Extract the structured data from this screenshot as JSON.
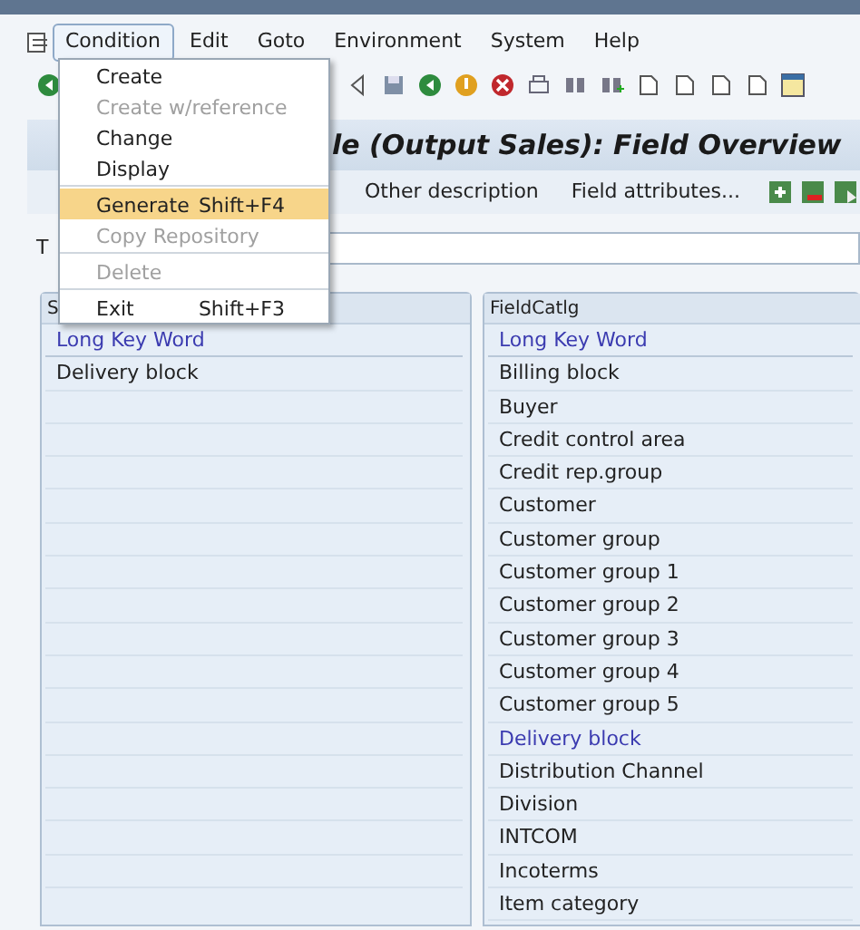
{
  "menu_bar": [
    {
      "label": "Condition",
      "selected": true
    },
    {
      "label": "Edit",
      "selected": false
    },
    {
      "label": "Goto",
      "selected": false
    },
    {
      "label": "Environment",
      "selected": false
    },
    {
      "label": "System",
      "selected": false
    },
    {
      "label": "Help",
      "selected": false
    }
  ],
  "dropdown": [
    {
      "kind": "item",
      "label": "Create",
      "disabled": false,
      "selected": false
    },
    {
      "kind": "item",
      "label": "Create w/reference",
      "disabled": true,
      "selected": false
    },
    {
      "kind": "item",
      "label": "Change",
      "disabled": false,
      "selected": false
    },
    {
      "kind": "item",
      "label": "Display",
      "disabled": false,
      "selected": false
    },
    {
      "kind": "separator"
    },
    {
      "kind": "item",
      "label": "Generate",
      "shortcut": "Shift+F4",
      "disabled": false,
      "selected": true
    },
    {
      "kind": "item",
      "label": "Copy Repository",
      "disabled": true,
      "selected": false
    },
    {
      "kind": "separator"
    },
    {
      "kind": "item",
      "label": "Delete",
      "disabled": true,
      "selected": false
    },
    {
      "kind": "separator"
    },
    {
      "kind": "item",
      "label": "Exit",
      "shortcut": "Shift+F3",
      "disabled": false,
      "selected": false
    }
  ],
  "title": "le (Output Sales): Field Overview",
  "app_toolbar": [
    "Other description",
    "Field attributes..."
  ],
  "field_label": "T",
  "left_pane": {
    "header": "S",
    "rows": [
      {
        "text": "Long Key Word",
        "kind": "heading"
      },
      {
        "text": "Delivery block",
        "kind": "normal"
      }
    ]
  },
  "right_pane": {
    "header": "FieldCatlg",
    "rows": [
      {
        "text": "Long Key Word",
        "kind": "heading"
      },
      {
        "text": "Billing block",
        "kind": "normal"
      },
      {
        "text": "Buyer",
        "kind": "normal"
      },
      {
        "text": "Credit control area",
        "kind": "normal"
      },
      {
        "text": "Credit rep.group",
        "kind": "normal"
      },
      {
        "text": "Customer",
        "kind": "normal"
      },
      {
        "text": "Customer group",
        "kind": "normal"
      },
      {
        "text": "Customer group 1",
        "kind": "normal"
      },
      {
        "text": "Customer group 2",
        "kind": "normal"
      },
      {
        "text": "Customer group 3",
        "kind": "normal"
      },
      {
        "text": "Customer group 4",
        "kind": "normal"
      },
      {
        "text": "Customer group 5",
        "kind": "normal"
      },
      {
        "text": "Delivery block",
        "kind": "used"
      },
      {
        "text": "Distribution Channel",
        "kind": "normal"
      },
      {
        "text": "Division",
        "kind": "normal"
      },
      {
        "text": "INTCOM",
        "kind": "normal"
      },
      {
        "text": "Incoterms",
        "kind": "normal"
      },
      {
        "text": "Item category",
        "kind": "normal"
      }
    ]
  }
}
